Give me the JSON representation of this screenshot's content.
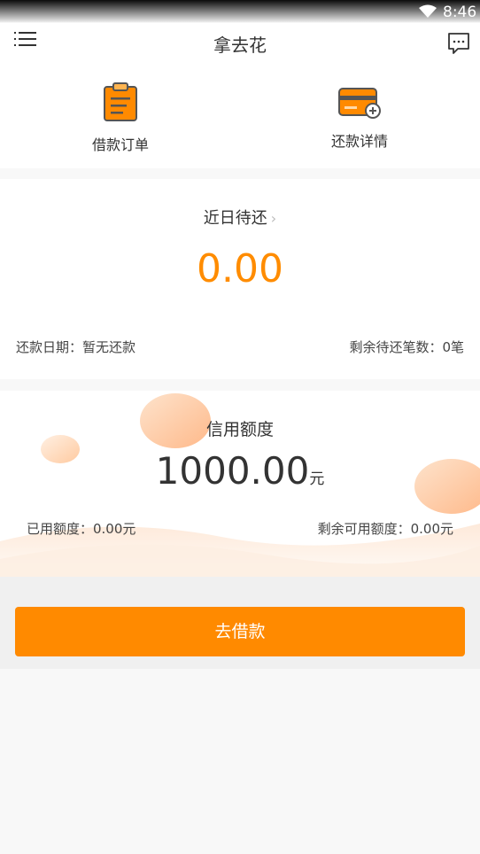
{
  "status_bar": {
    "time": "8:46",
    "icons": [
      "wifi-icon"
    ]
  },
  "header": {
    "title": "拿去花",
    "left_icon": "menu-icon",
    "right_icon": "message-icon"
  },
  "shortcuts": [
    {
      "label": "借款订单",
      "icon": "clipboard-icon"
    },
    {
      "label": "还款详情",
      "icon": "card-icon"
    }
  ],
  "recent_due": {
    "title": "近日待还",
    "amount": "0.00",
    "repay_date": "还款日期：暂无还款",
    "remaining_count": "剩余待还笔数：0笔"
  },
  "credit": {
    "title": "信用额度",
    "amount": "1000.00",
    "unit": "元",
    "used": "已用额度：0.00元",
    "available": "剩余可用额度：0.00元"
  },
  "borrow_button": {
    "label": "去借款"
  },
  "colors": {
    "accent": "#ff8a00",
    "amount": "#ff8c00"
  }
}
